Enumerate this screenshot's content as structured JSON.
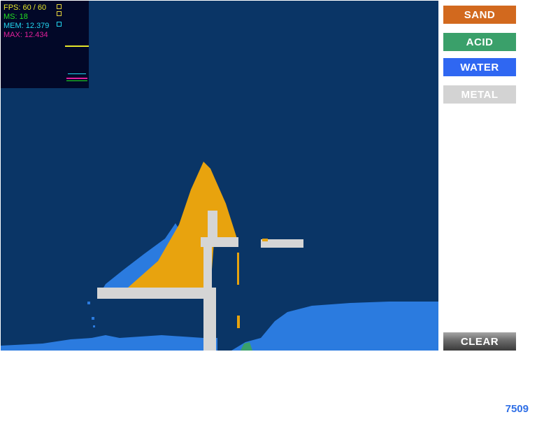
{
  "stats": {
    "fps": "FPS: 60 / 60",
    "ms": "MS: 18",
    "mem": "MEM: 12.379",
    "max": "MAX: 12.434",
    "colors": {
      "fps": "#e6e62a",
      "ms": "#22e022",
      "mem": "#22d6f0",
      "max": "#e0209a"
    }
  },
  "tools": {
    "sand": "SAND",
    "acid": "ACID",
    "water": "WATER",
    "metal": "METAL",
    "clear": "CLEAR"
  },
  "particle_count": "7509",
  "colors": {
    "background": "#0a3566",
    "sand": "#e8a30e",
    "water": "#2b7bdf",
    "metal": "#d5d5d5",
    "acid": "#3aa06a"
  }
}
